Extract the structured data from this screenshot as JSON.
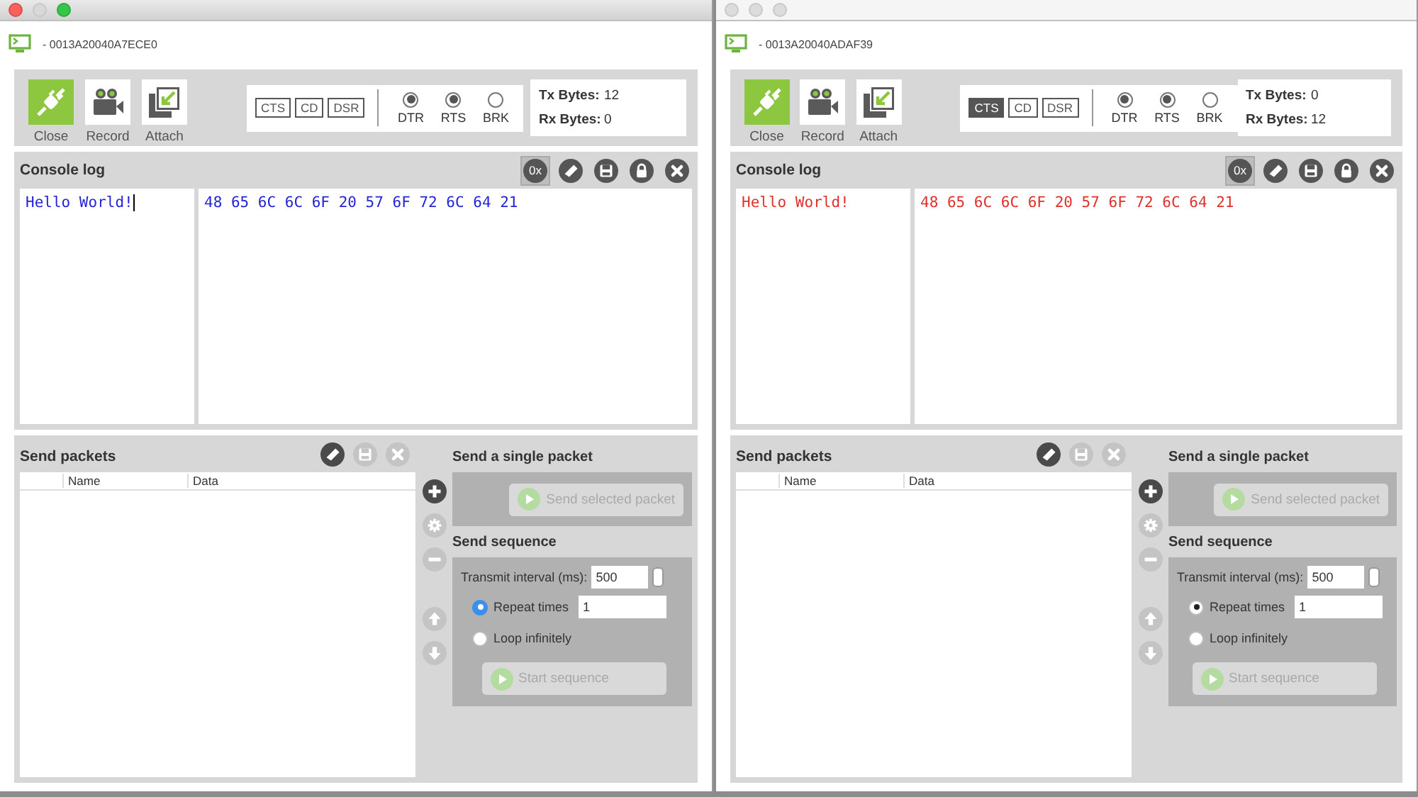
{
  "windows": [
    {
      "active": true,
      "title": "- 0013A20040A7ECE0",
      "toolbar": [
        {
          "label": "Close",
          "kind": "connection",
          "on": true
        },
        {
          "label": "Record",
          "kind": "record",
          "on": false
        },
        {
          "label": "Attach",
          "kind": "attach",
          "on": false
        }
      ],
      "lines": [
        {
          "label": "CTS",
          "on": false
        },
        {
          "label": "CD",
          "on": false
        },
        {
          "label": "DSR",
          "on": false
        }
      ],
      "controls": [
        {
          "label": "DTR",
          "checked": true
        },
        {
          "label": "RTS",
          "checked": true
        },
        {
          "label": "BRK",
          "checked": false
        }
      ],
      "counters": [
        {
          "label": "Tx Bytes:",
          "value": "12"
        },
        {
          "label": "Rx Bytes:",
          "value": "0"
        }
      ],
      "console": {
        "title": "Console log",
        "tools": [
          {
            "kind": "hex",
            "label": "0x",
            "selected": true
          },
          {
            "kind": "clear",
            "selected": false
          },
          {
            "kind": "save",
            "selected": false
          },
          {
            "kind": "lock",
            "selected": false
          },
          {
            "kind": "close",
            "selected": false
          }
        ],
        "ascii": "Hello World!",
        "hex": "48 65 6C 6C 6F 20 57 6F 72 6C 64 21",
        "color": "#2323d8",
        "cursor": true
      },
      "packets": {
        "title": "Send packets",
        "tools": [
          {
            "kind": "clear",
            "disabled": false
          },
          {
            "kind": "save",
            "disabled": true
          },
          {
            "kind": "close",
            "disabled": true
          }
        ],
        "columns": [
          "Name",
          "Data"
        ],
        "side_tools": [
          {
            "kind": "add",
            "disabled": false
          },
          {
            "kind": "settings",
            "disabled": true
          },
          {
            "kind": "remove",
            "disabled": true
          },
          {
            "kind": "up",
            "disabled": true
          },
          {
            "kind": "down",
            "disabled": true
          }
        ]
      },
      "single": {
        "title": "Send a single packet",
        "button": {
          "label": "Send selected packet",
          "disabled": true
        }
      },
      "sequence": {
        "title": "Send sequence",
        "interval_label": "Transmit interval (ms):",
        "interval": "500",
        "options": [
          {
            "label": "Repeat times",
            "selected": true,
            "value": "1"
          },
          {
            "label": "Loop infinitely",
            "selected": false
          }
        ],
        "button": {
          "label": "Start sequence",
          "disabled": true
        }
      }
    },
    {
      "active": false,
      "title": "- 0013A20040ADAF39",
      "toolbar": [
        {
          "label": "Close",
          "kind": "connection",
          "on": true
        },
        {
          "label": "Record",
          "kind": "record",
          "on": false
        },
        {
          "label": "Attach",
          "kind": "attach",
          "on": false
        }
      ],
      "lines": [
        {
          "label": "CTS",
          "on": true
        },
        {
          "label": "CD",
          "on": false
        },
        {
          "label": "DSR",
          "on": false
        }
      ],
      "controls": [
        {
          "label": "DTR",
          "checked": true
        },
        {
          "label": "RTS",
          "checked": true
        },
        {
          "label": "BRK",
          "checked": false
        }
      ],
      "counters": [
        {
          "label": "Tx Bytes:",
          "value": "0"
        },
        {
          "label": "Rx Bytes:",
          "value": "12"
        }
      ],
      "console": {
        "title": "Console log",
        "tools": [
          {
            "kind": "hex",
            "label": "0x",
            "selected": true
          },
          {
            "kind": "clear",
            "selected": false
          },
          {
            "kind": "save",
            "selected": false
          },
          {
            "kind": "lock",
            "selected": false
          },
          {
            "kind": "close",
            "selected": false
          }
        ],
        "ascii": "Hello World!",
        "hex": "48 65 6C 6C 6F 20 57 6F 72 6C 64 21",
        "color": "#e0302a",
        "cursor": false
      },
      "packets": {
        "title": "Send packets",
        "tools": [
          {
            "kind": "clear",
            "disabled": false
          },
          {
            "kind": "save",
            "disabled": true
          },
          {
            "kind": "close",
            "disabled": true
          }
        ],
        "columns": [
          "Name",
          "Data"
        ],
        "side_tools": [
          {
            "kind": "add",
            "disabled": false
          },
          {
            "kind": "settings",
            "disabled": true
          },
          {
            "kind": "remove",
            "disabled": true
          },
          {
            "kind": "up",
            "disabled": true
          },
          {
            "kind": "down",
            "disabled": true
          }
        ]
      },
      "single": {
        "title": "Send a single packet",
        "button": {
          "label": "Send selected packet",
          "disabled": true
        }
      },
      "sequence": {
        "title": "Send sequence",
        "interval_label": "Transmit interval (ms):",
        "interval": "500",
        "options": [
          {
            "label": "Repeat times",
            "selected": true,
            "value": "1"
          },
          {
            "label": "Loop infinitely",
            "selected": false
          }
        ],
        "button": {
          "label": "Start sequence",
          "disabled": true
        }
      }
    }
  ]
}
